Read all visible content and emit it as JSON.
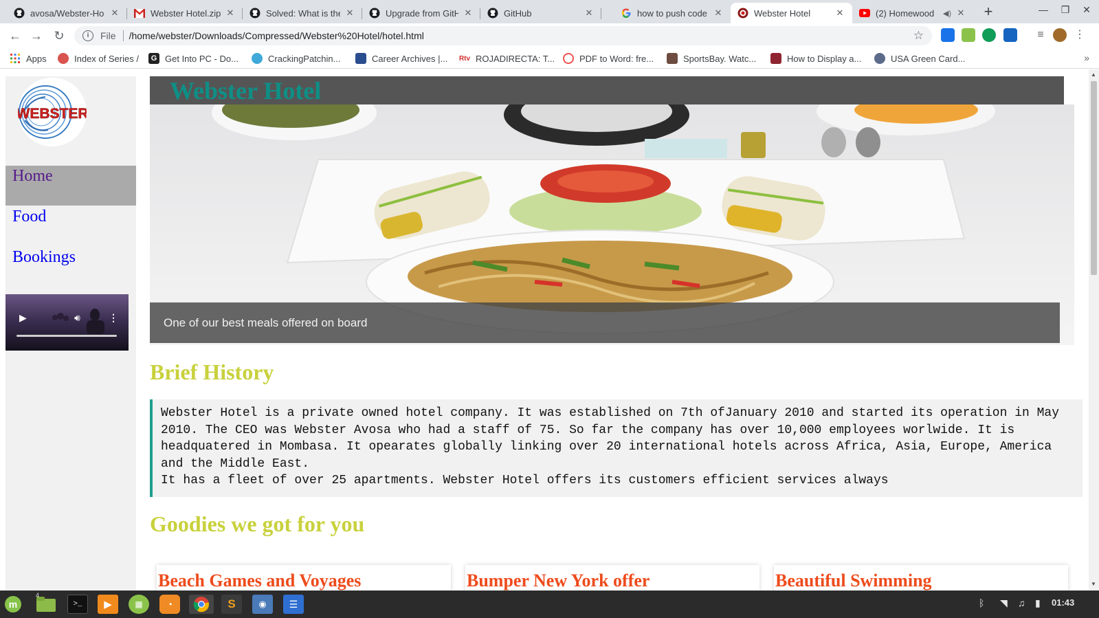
{
  "browser": {
    "tabs": [
      {
        "title": "avosa/Webster-Ho",
        "icon": "github-icon"
      },
      {
        "title": "Webster Hotel.zip",
        "icon": "gmail-icon"
      },
      {
        "title": "Solved: What is the",
        "icon": "github-icon"
      },
      {
        "title": "Upgrade from GitH",
        "icon": "github-icon"
      },
      {
        "title": "GitHub",
        "icon": "github-icon"
      },
      {
        "title": "how to push code t",
        "icon": "google-icon"
      },
      {
        "title": "Webster Hotel",
        "icon": "webster-favicon",
        "active": true
      },
      {
        "title": "(2) Homewood",
        "icon": "youtube-icon",
        "audio": true
      }
    ],
    "close_glyph": "✕",
    "new_tab_glyph": "+",
    "url_scheme": "File",
    "url": "/home/webster/Downloads/Compressed/Webster%20Hotel/hotel.html",
    "bookmarks": [
      {
        "label": "Apps",
        "icon": "apps-grid-icon"
      },
      {
        "label": "Index of Series /",
        "icon": "series-icon"
      },
      {
        "label": "Get Into PC - Do...",
        "icon": "getintopc-icon"
      },
      {
        "label": "CrackingPatchin...",
        "icon": "cracking-icon"
      },
      {
        "label": "Career Archives |...",
        "icon": "career-icon"
      },
      {
        "label": "ROJADIRECTA: T...",
        "icon": "rojadirecta-icon"
      },
      {
        "label": "PDF to Word: fre...",
        "icon": "pdf-icon"
      },
      {
        "label": "SportsBay. Watc...",
        "icon": "sportsbay-icon"
      },
      {
        "label": "How to Display a...",
        "icon": "howto-icon"
      },
      {
        "label": "USA Green Card...",
        "icon": "greencard-icon"
      }
    ],
    "bookmarks_more": "»"
  },
  "page": {
    "site_title": "Webster Hotel",
    "logo_text": "WEBSTER",
    "nav": [
      {
        "label": "Home",
        "active": true
      },
      {
        "label": "Food"
      },
      {
        "label": "Bookings"
      }
    ],
    "hero_caption": "One of our best meals offered on board",
    "history_heading": "Brief History",
    "history_text_1": "Webster Hotel is a private owned hotel company. It was established on 7th ofJanuary 2010 and started its operation in May 2010. The CEO was Webster Avosa who had a staff of 75. So far the company has over 10,000 employees worlwide. It is headquatered in Mombasa. It opearates globally linking over 20 international hotels across Africa, Asia, Europe, America and the Middle East.",
    "history_text_2": "It has a fleet of over 25 apartments. Webster Hotel offers its customers efficient services always",
    "goodies_heading": "Goodies we got for you",
    "cards": [
      {
        "title": "Beach Games and Voyages"
      },
      {
        "title": "Bumper New York offer"
      },
      {
        "title": "Beautiful Swimming"
      }
    ]
  },
  "taskbar": {
    "workspace_badge": "4",
    "clock": "01:43"
  },
  "colors": {
    "site_title": "#0e8f86",
    "section_heading": "#c8d13c",
    "card_title": "#ee4b1c",
    "history_border": "#1f9e8f",
    "nav_active_bg": "#aaaaaa"
  }
}
